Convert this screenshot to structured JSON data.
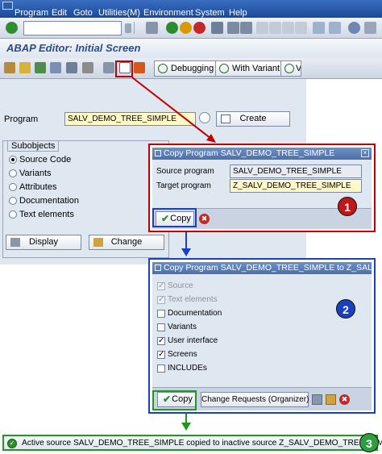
{
  "menu": [
    "Program",
    "Edit",
    "Goto",
    "Utilities(M)",
    "Environment",
    "System",
    "Help"
  ],
  "screen_title": "ABAP Editor: Initial Screen",
  "toolbar2": {
    "debugging_label": "Debugging",
    "with_variant_label": "With Variant",
    "truncated_label": "Va"
  },
  "program": {
    "label": "Program",
    "value": "SALV_DEMO_TREE_SIMPLE",
    "create_label": "Create"
  },
  "subobjects": {
    "title": "Subobjects",
    "options": [
      "Source Code",
      "Variants",
      "Attributes",
      "Documentation",
      "Text elements"
    ],
    "selected": 0,
    "display_label": "Display",
    "change_label": "Change"
  },
  "dialog1": {
    "title": "Copy Program SALV_DEMO_TREE_SIMPLE",
    "source_label": "Source program",
    "source_value": "SALV_DEMO_TREE_SIMPLE",
    "target_label": "Target program",
    "target_value": "Z_SALV_DEMO_TREE_SIMPLE",
    "copy_label": "Copy",
    "step": "1"
  },
  "dialog2": {
    "title": "Copy Program SALV_DEMO_TREE_SIMPLE to Z_SALV...",
    "options": [
      {
        "label": "Source",
        "checked": true,
        "disabled": true
      },
      {
        "label": "Text elements",
        "checked": true,
        "disabled": true
      },
      {
        "label": "Documentation",
        "checked": false,
        "disabled": false
      },
      {
        "label": "Variants",
        "checked": false,
        "disabled": false
      },
      {
        "label": "User interface",
        "checked": true,
        "disabled": false
      },
      {
        "label": "Screens",
        "checked": true,
        "disabled": false
      },
      {
        "label": "INCLUDEs",
        "checked": false,
        "disabled": false
      }
    ],
    "copy_label": "Copy",
    "change_requests_label": "Change Requests (Organizer)",
    "step": "2"
  },
  "status": {
    "message": "Active source SALV_DEMO_TREE_SIMPLE copied to inactive source Z_SALV_DEMO_TREE_SIMPLE",
    "step": "3"
  },
  "colors": {
    "sap_blue": "#1c4896",
    "highlight_red": "#c00000",
    "highlight_blue": "#1a3fc0",
    "highlight_green": "#1f9a1f",
    "badge_green": "#2e9e3e"
  }
}
